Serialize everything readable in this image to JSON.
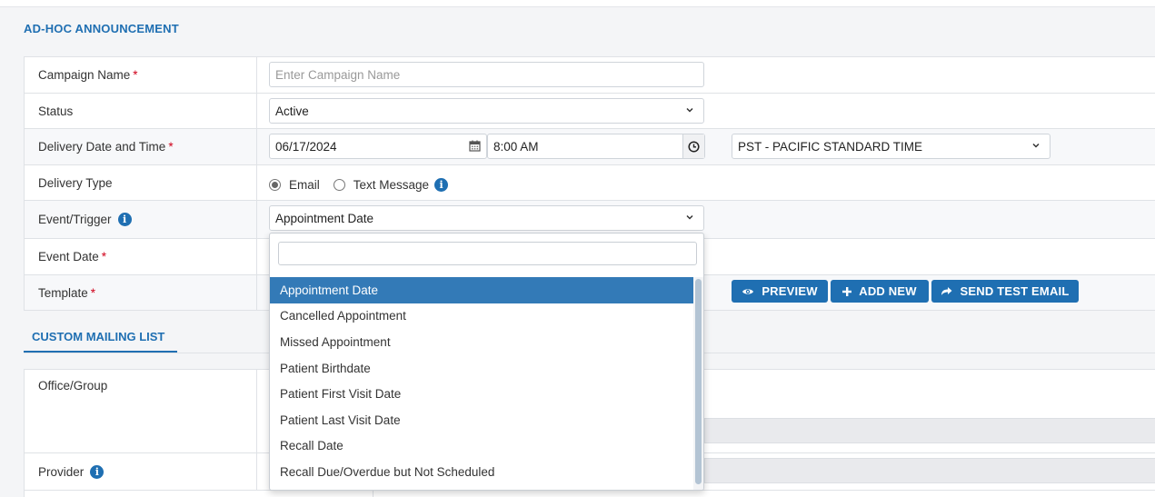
{
  "header": {
    "title": "AD-HOC ANNOUNCEMENT"
  },
  "form": {
    "campaign_name": {
      "label": "Campaign Name",
      "required": "*",
      "placeholder": "Enter Campaign Name"
    },
    "status": {
      "label": "Status",
      "value": "Active"
    },
    "delivery": {
      "label": "Delivery Date and Time",
      "required": "*",
      "date": "06/17/2024",
      "time": "8:00 AM",
      "timezone": "PST - PACIFIC STANDARD TIME"
    },
    "delivery_type": {
      "label": "Delivery Type",
      "options": [
        "Email",
        "Text Message"
      ],
      "selected": "Email"
    },
    "event_trigger": {
      "label": "Event/Trigger",
      "value": "Appointment Date"
    },
    "event_date": {
      "label": "Event Date",
      "required": "*"
    },
    "template": {
      "label": "Template",
      "required": "*"
    }
  },
  "buttons": {
    "preview": "PREVIEW",
    "add_new": "ADD NEW",
    "send_test_email": "SEND TEST EMAIL"
  },
  "mailing": {
    "tab": "CUSTOM MAILING LIST",
    "office_group_label": "Office/Group",
    "provider_label": "Provider"
  },
  "dropdown": {
    "search_value": "",
    "items": [
      "Appointment Date",
      "Cancelled Appointment",
      "Missed Appointment",
      "Patient Birthdate",
      "Patient First Visit Date",
      "Patient Last Visit Date",
      "Recall Date",
      "Recall Due/Overdue but Not Scheduled"
    ],
    "selected_index": 0
  },
  "icons": {
    "info": "info-circle-icon",
    "calendar": "calendar-icon",
    "clock": "clock-icon",
    "chevron": "chevron-down-icon",
    "eye": "eye-icon",
    "plus": "plus-icon",
    "share": "share-arrow-icon"
  },
  "colors": {
    "accent": "#1f6fb2",
    "selected": "#337ab7",
    "required": "#d0021b"
  }
}
